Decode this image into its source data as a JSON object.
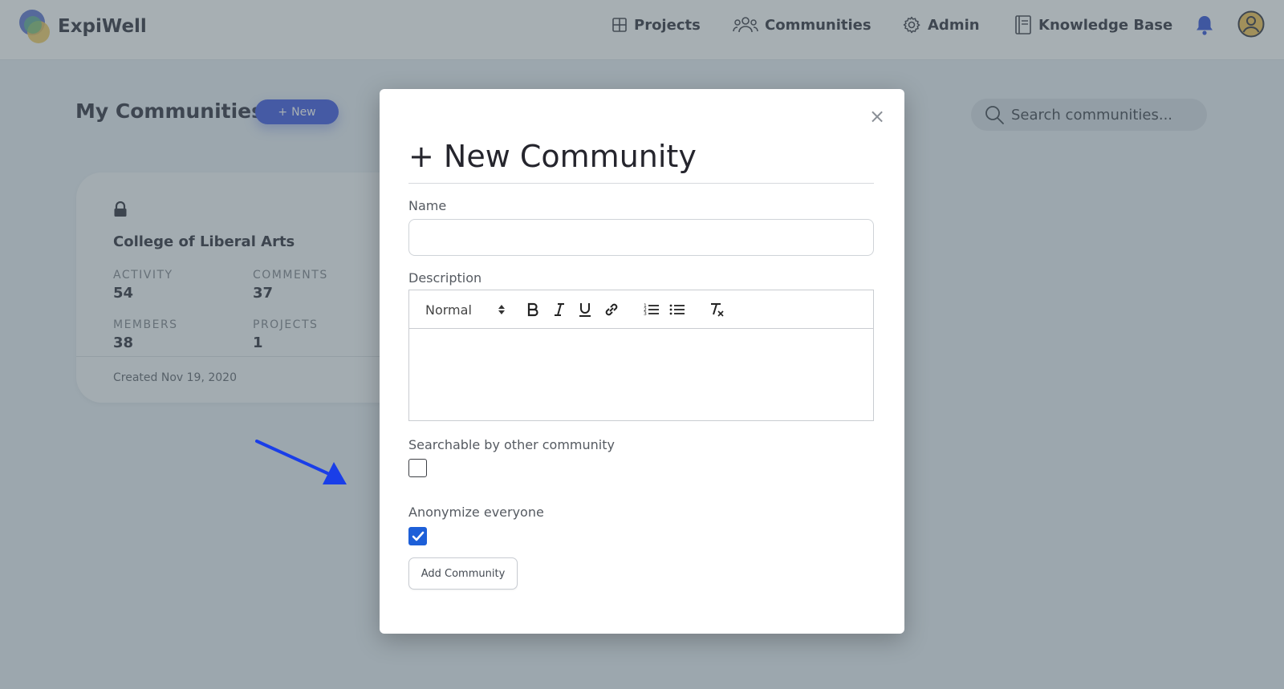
{
  "app": {
    "brand": "ExpiWell"
  },
  "nav": {
    "projects": "Projects",
    "communities": "Communities",
    "admin": "Admin",
    "knowledge_base": "Knowledge Base"
  },
  "page": {
    "title": "My Communities",
    "new_button": "New",
    "search_placeholder": "Search communities..."
  },
  "community_card": {
    "name": "College of Liberal Arts",
    "stats": [
      {
        "label": "ACTIVITY",
        "value": "54"
      },
      {
        "label": "COMMENTS",
        "value": "37"
      },
      {
        "label": "MEMBERS",
        "value": "38"
      },
      {
        "label": "PROJECTS",
        "value": "1"
      }
    ],
    "created": "Created Nov 19, 2020"
  },
  "modal": {
    "title": "+ New Community",
    "close_symbol": "×",
    "name_label": "Name",
    "name_value": "",
    "description_label": "Description",
    "format_select": "Normal",
    "searchable_label": "Searchable by other community",
    "searchable_checked": false,
    "anonymize_label": "Anonymize everyone",
    "anonymize_checked": true,
    "submit_label": "Add Community"
  },
  "colors": {
    "accent": "#3b55e0",
    "checkbox_checked": "#1d5fd8",
    "annotation_arrow": "#1a3ee8",
    "overlay": "#506068"
  }
}
